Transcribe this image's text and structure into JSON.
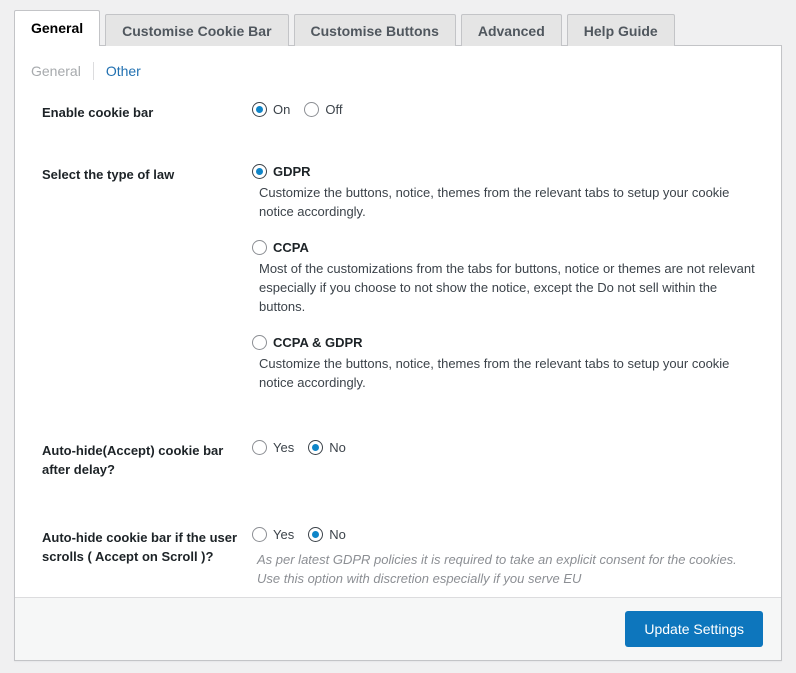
{
  "tabs": [
    {
      "label": "General",
      "active": true
    },
    {
      "label": "Customise Cookie Bar",
      "active": false
    },
    {
      "label": "Customise Buttons",
      "active": false
    },
    {
      "label": "Advanced",
      "active": false
    },
    {
      "label": "Help Guide",
      "active": false
    }
  ],
  "subnav": {
    "current": "General",
    "link": "Other"
  },
  "settings": {
    "enable_cookie_bar": {
      "label": "Enable cookie bar",
      "options": [
        {
          "label": "On",
          "checked": true
        },
        {
          "label": "Off",
          "checked": false
        }
      ]
    },
    "type_of_law": {
      "label": "Select the type of law",
      "options": [
        {
          "label": "GDPR",
          "checked": true,
          "description": "Customize the buttons, notice, themes from the relevant tabs to setup your cookie notice accordingly."
        },
        {
          "label": "CCPA",
          "checked": false,
          "description": "Most of the customizations from the tabs for buttons, notice or themes are not relevant especially if you choose to not show the notice, except the Do not sell within the buttons."
        },
        {
          "label": "CCPA & GDPR",
          "checked": false,
          "description": "Customize the buttons, notice, themes from the relevant tabs to setup your cookie notice accordingly."
        }
      ]
    },
    "auto_hide_accept": {
      "label": "Auto-hide(Accept) cookie bar after delay?",
      "options": [
        {
          "label": "Yes",
          "checked": false
        },
        {
          "label": "No",
          "checked": true
        }
      ]
    },
    "auto_hide_scroll": {
      "label": "Auto-hide cookie bar if the user scrolls ( Accept on Scroll )?",
      "options": [
        {
          "label": "Yes",
          "checked": false
        },
        {
          "label": "No",
          "checked": true
        }
      ],
      "description": "As per latest GDPR policies it is required to take an explicit consent for the cookies. Use this option with discretion especially if you serve EU"
    }
  },
  "footer": {
    "submit_label": "Update Settings"
  },
  "colors": {
    "accent": "#0f85c8",
    "button": "#0d76bd",
    "link": "#2271b1",
    "panel_bg": "#ffffff",
    "page_bg": "#f0f0f1",
    "footer_bg": "#f6f7f7",
    "border": "#c3c4c7",
    "muted_text": "#8c8f94"
  }
}
